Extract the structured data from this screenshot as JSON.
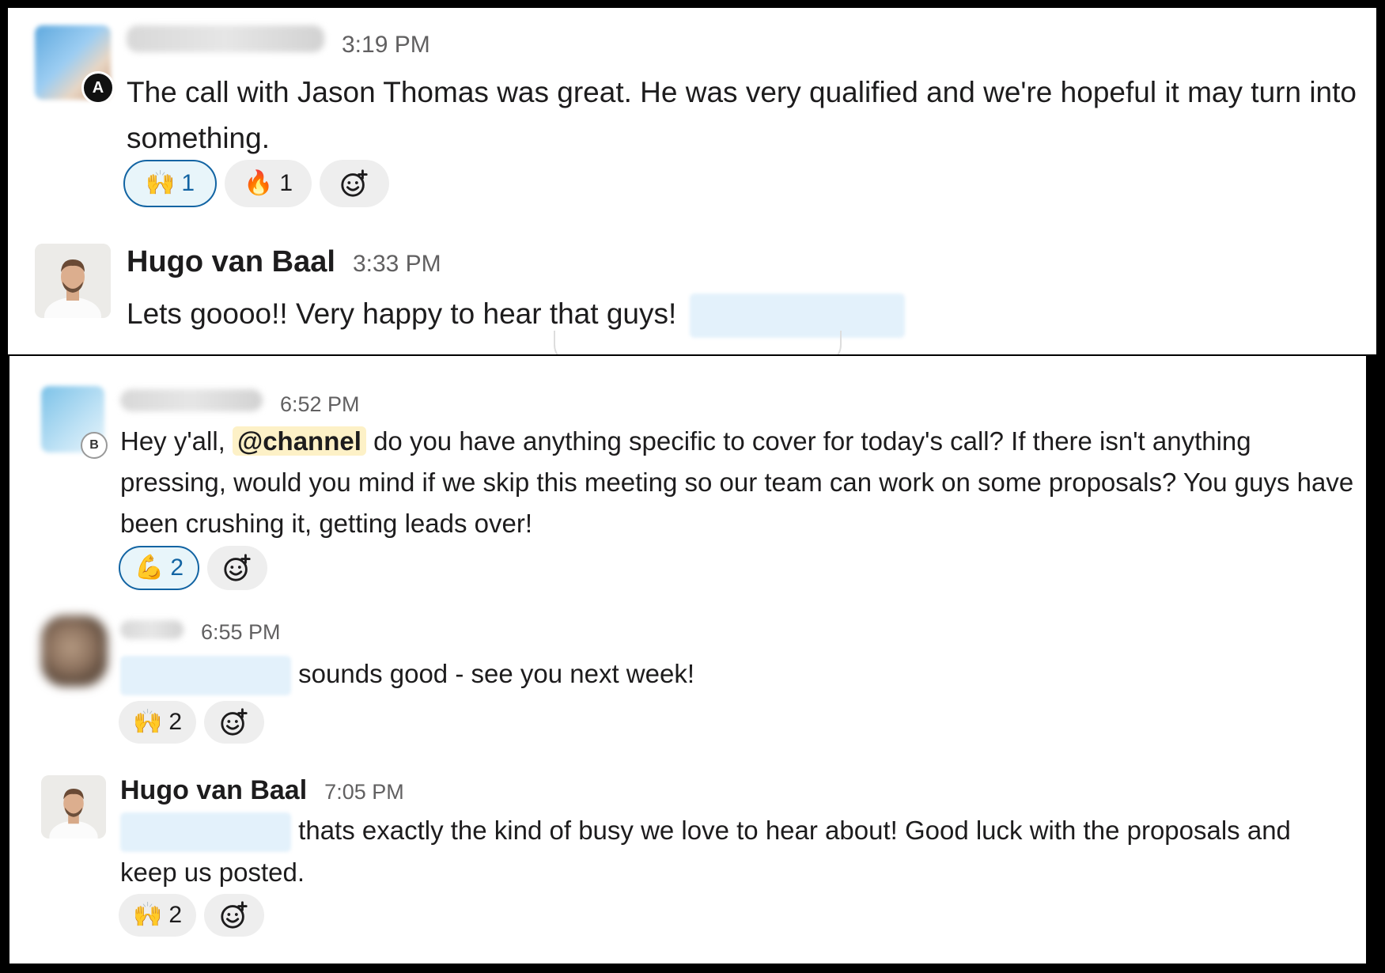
{
  "messages": [
    {
      "author": "",
      "time": "3:19 PM",
      "text": "The call with Jason Thomas was great. He was very qualified and we're hopeful it may turn into something.",
      "badge": "A",
      "reactions": [
        {
          "emoji": "🙌",
          "count": "1",
          "active": true
        },
        {
          "emoji": "🔥",
          "count": "1",
          "active": false
        }
      ]
    },
    {
      "author": "Hugo van Baal",
      "time": "3:33 PM",
      "text": "Lets goooo!! Very happy to hear that guys!"
    },
    {
      "author": "",
      "time": "6:52 PM",
      "badge": "B",
      "text_before": "Hey y'all,",
      "mention": "@channel",
      "text_after": "do you have anything specific to cover for today's call? If there isn't anything pressing, would you mind if we skip this meeting so our team can work on some proposals? You guys have been crushing it, getting leads over!",
      "reactions": [
        {
          "emoji": "💪",
          "count": "2",
          "active": true
        }
      ]
    },
    {
      "author": "",
      "time": "6:55 PM",
      "text": "sounds good - see you next week!",
      "reactions": [
        {
          "emoji": "🙌",
          "count": "2",
          "active": false
        }
      ]
    },
    {
      "author": "Hugo van Baal",
      "time": "7:05 PM",
      "text": "thats exactly the kind of busy we love to hear about! Good luck with the proposals and keep us posted.",
      "reactions": [
        {
          "emoji": "🙌",
          "count": "2",
          "active": false
        }
      ]
    }
  ],
  "icons": {
    "add_reaction": "add-reaction-icon"
  },
  "colors": {
    "mention_bg": "#fdf1c7",
    "active_reaction_border": "#1264a3",
    "time": "#616061"
  }
}
